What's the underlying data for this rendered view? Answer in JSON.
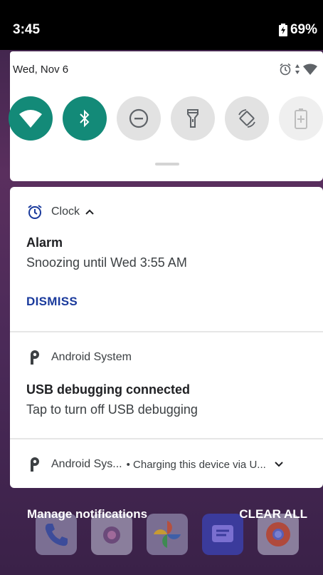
{
  "status": {
    "time": "3:45",
    "battery": "69%"
  },
  "quick_settings": {
    "date": "Wed, Nov 6",
    "tiles": [
      {
        "name": "wifi",
        "state": "on"
      },
      {
        "name": "bluetooth",
        "state": "on"
      },
      {
        "name": "do-not-disturb",
        "state": "off"
      },
      {
        "name": "flashlight",
        "state": "off"
      },
      {
        "name": "auto-rotate",
        "state": "off"
      },
      {
        "name": "battery-saver",
        "state": "unavailable"
      }
    ]
  },
  "notifications": [
    {
      "app": "Clock",
      "title": "Alarm",
      "body": "Snoozing until Wed 3:55 AM",
      "action": "DISMISS"
    },
    {
      "app": "Android System",
      "title": "USB debugging connected",
      "body": "Tap to turn off USB debugging"
    },
    {
      "app": "Android Sys...",
      "summary": "• Charging this device via U..."
    }
  ],
  "footer": {
    "manage": "Manage notifications",
    "clear_all": "CLEAR ALL"
  },
  "colors": {
    "accent": "#138a78",
    "action": "#1a3a9c"
  }
}
